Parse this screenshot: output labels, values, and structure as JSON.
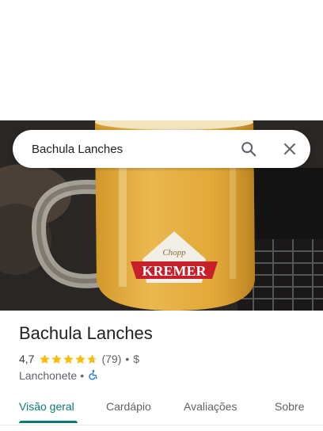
{
  "search": {
    "query": "Bachula Lanches",
    "search_icon": "search-icon",
    "close_icon": "close-icon"
  },
  "hero": {
    "description_icon": "photo",
    "logo_top_text": "Chopp",
    "logo_main_text": "KREMER"
  },
  "place": {
    "name": "Bachula Lanches",
    "rating": "4,7",
    "rating_fraction": 0.94,
    "review_count": "(79)",
    "separator": "•",
    "price": "$",
    "category": "Lanchonete",
    "accessibility_icon": "wheelchair-icon"
  },
  "tabs": [
    {
      "label": "Visão geral",
      "active": true
    },
    {
      "label": "Cardápio",
      "active": false
    },
    {
      "label": "Avaliações",
      "active": false
    },
    {
      "label": "Sobre",
      "active": false
    }
  ],
  "colors": {
    "accent": "#0b7a75",
    "star": "#fbbc04",
    "accessibility": "#1a73e8"
  }
}
